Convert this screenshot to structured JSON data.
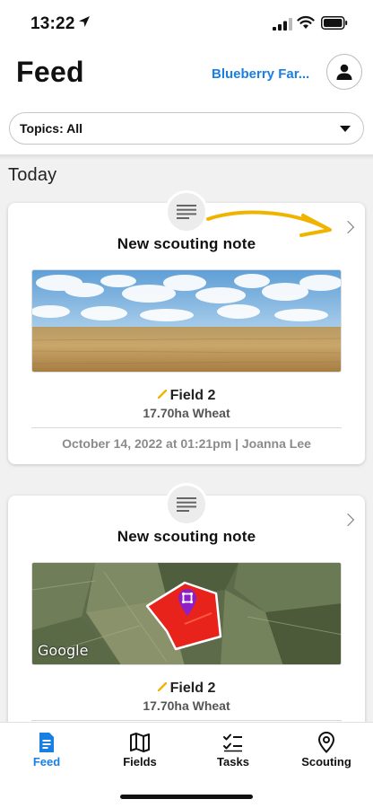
{
  "status_bar": {
    "time": "13:22"
  },
  "header": {
    "title": "Feed",
    "farm_name": "Blueberry Far...",
    "topics_filter": "Topics: All"
  },
  "feed": {
    "section_heading": "Today",
    "cards": [
      {
        "title": "New scouting note",
        "field": "Field 2",
        "area_crop": "17.70ha  Wheat",
        "footer": "October 14, 2022 at 01:21pm  |  Joanna Lee",
        "image_type": "wheat-field-photo"
      },
      {
        "title": "New scouting note",
        "field": "Field 2",
        "area_crop": "17.70ha  Wheat",
        "image_type": "satellite-map",
        "map_brand": "Google"
      }
    ]
  },
  "tabs": [
    {
      "label": "Feed",
      "icon": "document-icon",
      "active": true
    },
    {
      "label": "Fields",
      "icon": "map-icon",
      "active": false
    },
    {
      "label": "Tasks",
      "icon": "checklist-icon",
      "active": false
    },
    {
      "label": "Scouting",
      "icon": "location-pin-icon",
      "active": false
    }
  ],
  "colors": {
    "accent": "#1a7fe3",
    "annotation_arrow": "#f0b400",
    "field_highlight": "#e8231c",
    "pin": "#8e1fc7"
  }
}
